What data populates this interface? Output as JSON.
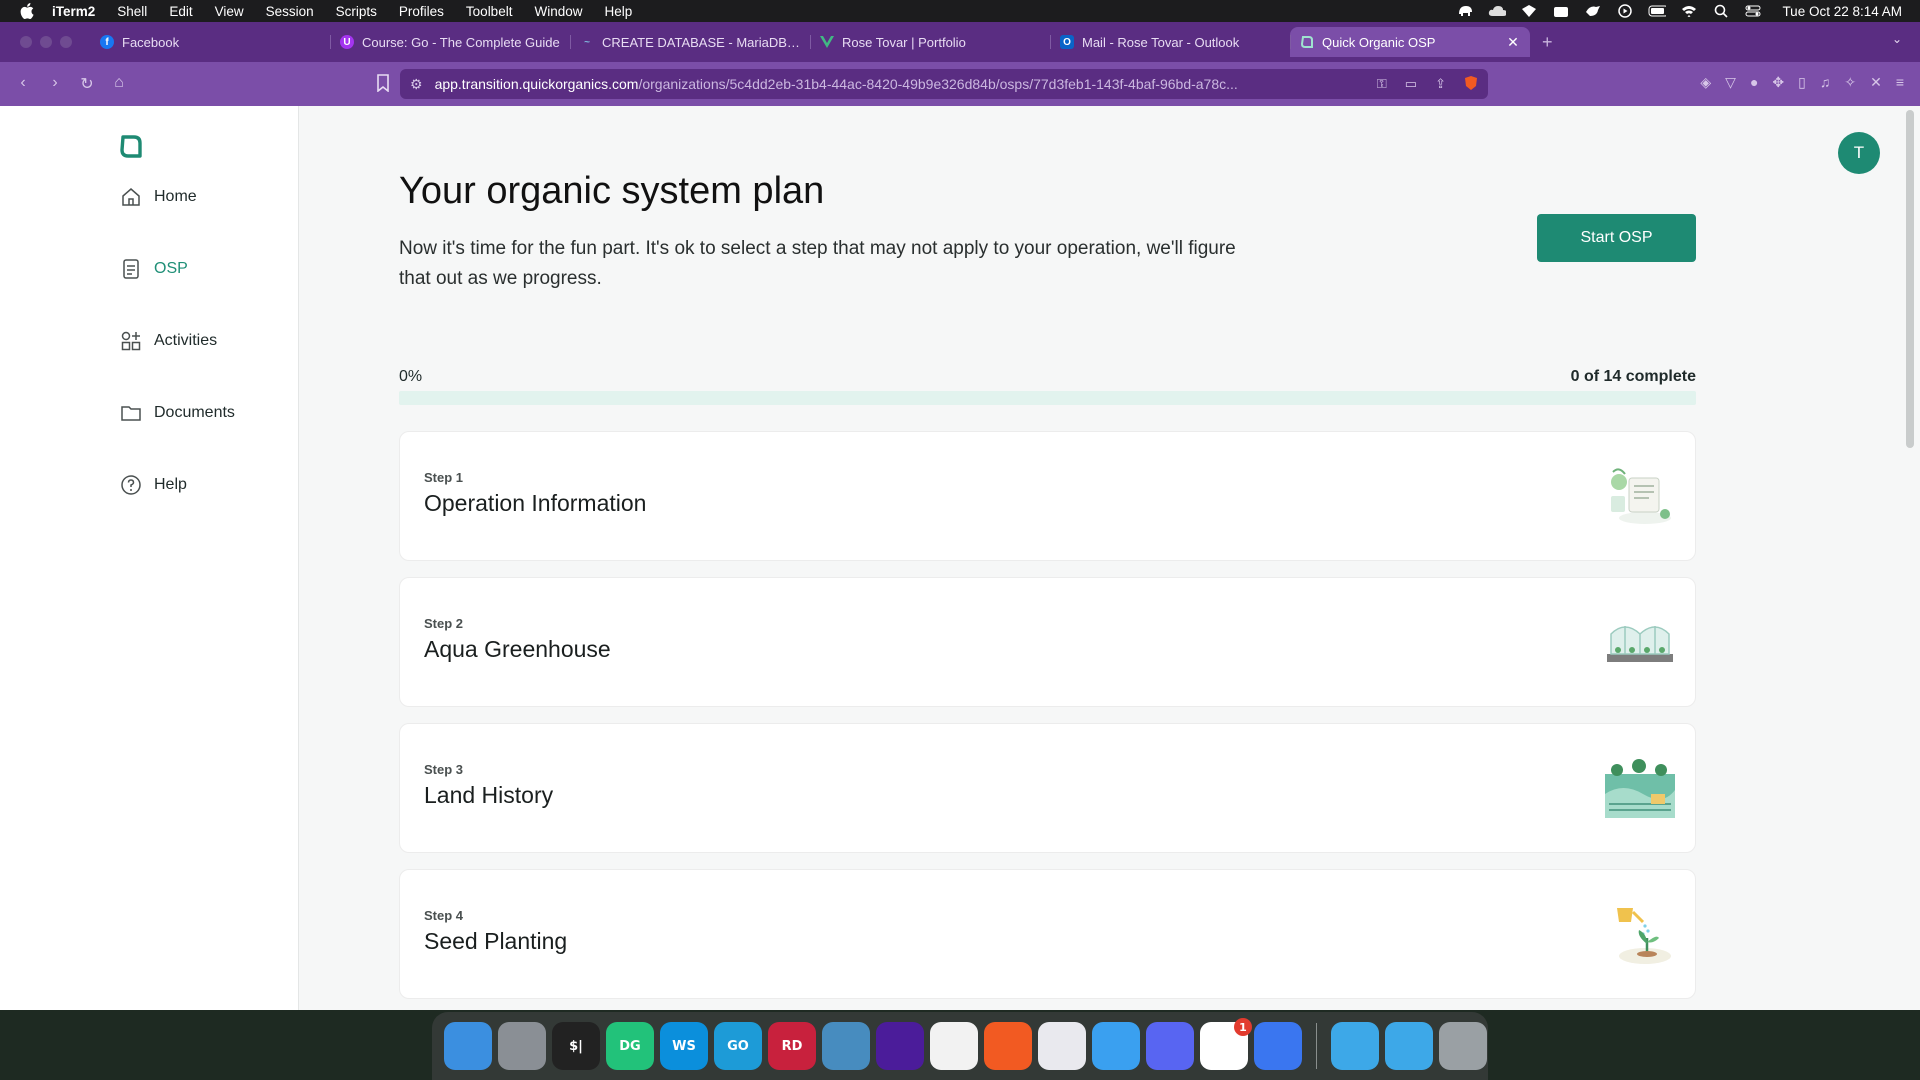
{
  "menubar": {
    "app_name": "iTerm2",
    "menus": [
      "Shell",
      "Edit",
      "View",
      "Session",
      "Scripts",
      "Profiles",
      "Toolbelt",
      "Window",
      "Help"
    ],
    "clock": "Tue Oct 22  8:14 AM"
  },
  "browser": {
    "tabs": [
      {
        "title": "Facebook",
        "icon": "facebook-icon",
        "color": "#1877f2"
      },
      {
        "title": "Course: Go - The Complete Guide",
        "icon": "udemy-icon",
        "color": "#a435f0"
      },
      {
        "title": "CREATE DATABASE - MariaDB Kn",
        "icon": "mariadb-icon",
        "color": "#3a7ca5"
      },
      {
        "title": "Rose Tovar | Portfolio",
        "icon": "vue-icon",
        "color": "#41b883"
      },
      {
        "title": "Mail - Rose Tovar - Outlook",
        "icon": "outlook-icon",
        "color": "#0a64c8"
      },
      {
        "title": "Quick Organic OSP",
        "icon": "quickorganics-icon",
        "color": "#1e8a73",
        "active": true
      }
    ],
    "url_host": "app.transition.quickorganics.com",
    "url_path": "/organizations/5c4dd2eb-31b4-44ac-8420-49b9e326d84b/osps/77d3feb1-143f-4baf-96bd-a78c..."
  },
  "sidebar": {
    "items": [
      {
        "label": "Home",
        "icon": "home-icon",
        "active": false
      },
      {
        "label": "OSP",
        "icon": "document-icon",
        "active": true
      },
      {
        "label": "Activities",
        "icon": "activities-icon",
        "active": false
      },
      {
        "label": "Documents",
        "icon": "folder-icon",
        "active": false
      },
      {
        "label": "Help",
        "icon": "help-icon",
        "active": false
      }
    ]
  },
  "user": {
    "avatar_initial": "T"
  },
  "main": {
    "title": "Your organic system plan",
    "description": "Now it's time for the fun part. It's ok to select a step that may not apply to your operation, we'll figure that out as we progress.",
    "start_button": "Start OSP",
    "progress": {
      "percent_label": "0%",
      "percent": 0,
      "count_label": "0 of 14 complete"
    },
    "steps": [
      {
        "number": "Step 1",
        "title": "Operation Information",
        "icon": "operation-illustration"
      },
      {
        "number": "Step 2",
        "title": "Aqua Greenhouse",
        "icon": "greenhouse-illustration"
      },
      {
        "number": "Step 3",
        "title": "Land History",
        "icon": "land-illustration"
      },
      {
        "number": "Step 4",
        "title": "Seed Planting",
        "icon": "seed-illustration"
      }
    ]
  },
  "accent_color": "#1e8a73",
  "dock": {
    "apps": [
      {
        "name": "finder-icon",
        "label": "",
        "color": "#3b8fe0"
      },
      {
        "name": "launchpad-icon",
        "label": "",
        "color": "#8a8f95"
      },
      {
        "name": "iterm-icon",
        "label": "$|",
        "color": "#222"
      },
      {
        "name": "datagrip-icon",
        "label": "DG",
        "color": "#22c27a"
      },
      {
        "name": "webstorm-icon",
        "label": "WS",
        "color": "#0b8fdc"
      },
      {
        "name": "goland-icon",
        "label": "GO",
        "color": "#1d9bd7"
      },
      {
        "name": "rider-icon",
        "label": "RD",
        "color": "#c8213d"
      },
      {
        "name": "godot-icon",
        "label": "",
        "color": "#478cbf"
      },
      {
        "name": "arc-icon",
        "label": "",
        "color": "#4b1c9a"
      },
      {
        "name": "notes-icon",
        "label": "",
        "color": "#f2f2f2"
      },
      {
        "name": "brave-icon",
        "label": "",
        "color": "#f25a22"
      },
      {
        "name": "mail-icon",
        "label": "",
        "color": "#e9e9ee"
      },
      {
        "name": "testflight-icon",
        "label": "",
        "color": "#3aa0f0"
      },
      {
        "name": "discord-icon",
        "label": "",
        "color": "#5865f2"
      },
      {
        "name": "slack-icon",
        "label": "",
        "color": "#ffffff",
        "badge": "1"
      },
      {
        "name": "signal-icon",
        "label": "",
        "color": "#3a76f0"
      },
      {
        "name": "folder-blue-icon",
        "label": "",
        "color": "#3da8e8"
      },
      {
        "name": "folder-blue-icon-2",
        "label": "",
        "color": "#3da8e8"
      },
      {
        "name": "trash-icon",
        "label": "",
        "color": "#9aa0a4"
      }
    ]
  }
}
